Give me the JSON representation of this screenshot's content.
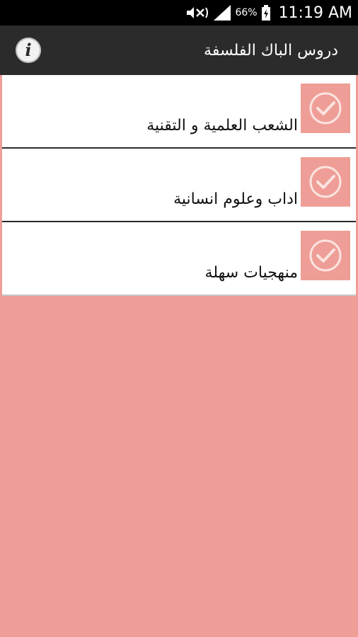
{
  "status_bar": {
    "battery_percent": "66%",
    "time": "11:19 AM",
    "icons": [
      "mute-icon",
      "signal-icon",
      "battery-charging-icon"
    ]
  },
  "action_bar": {
    "title": "دروس الباك الفلسفة",
    "info_icon": "info-icon",
    "info_glyph": "i"
  },
  "list": {
    "items": [
      {
        "label": "الشعب العلمية و التقنية",
        "icon": "checkmark-circle-icon"
      },
      {
        "label": "اداب وعلوم انسانية",
        "icon": "checkmark-circle-icon"
      },
      {
        "label": "منهجيات سهلة",
        "icon": "checkmark-circle-icon"
      }
    ]
  },
  "colors": {
    "background": "#ee9e96",
    "action_bar": "#2b2b2b",
    "status_bar": "#000000",
    "list_item": "#ffffff"
  }
}
